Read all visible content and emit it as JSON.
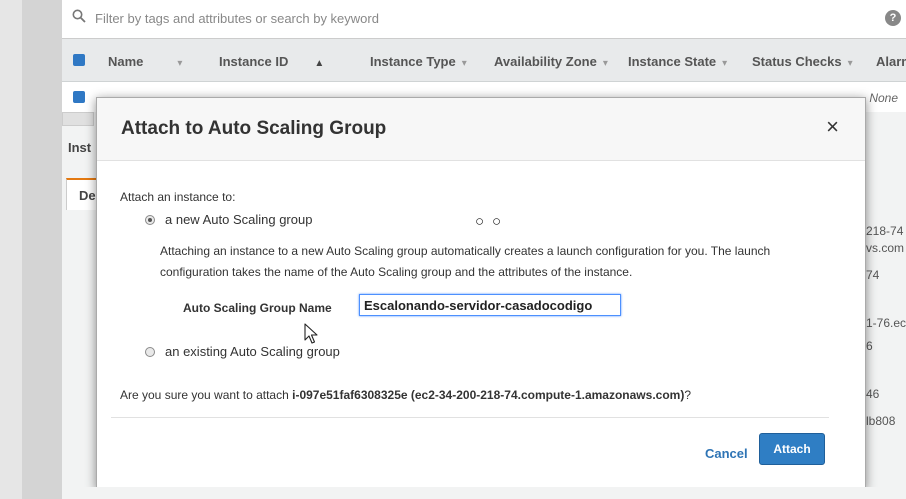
{
  "console": {
    "search_placeholder": "Filter by tags and attributes or search by keyword",
    "help_label": "?",
    "columns": [
      "Name",
      "Instance ID",
      "Instance Type",
      "Availability Zone",
      "Instance State",
      "Status Checks",
      "Alarm"
    ],
    "alarm_value": "None",
    "instances_label": "Inst",
    "details_tab": "De",
    "right_fragments": [
      "218-74",
      "vs.com",
      "74",
      "1-76.ec",
      "6",
      "46",
      "lb808"
    ]
  },
  "modal": {
    "title": "Attach to Auto Scaling Group",
    "close_label": "×",
    "attach_prompt": "Attach an instance to:",
    "option_new": "a new Auto Scaling group",
    "option_existing": "an existing Auto Scaling group",
    "selected_option": "new",
    "explanation": "Attaching an instance to a new Auto Scaling group automatically creates a launch configuration for you. The launch configuration takes the name of the Auto Scaling group and the attributes of the instance.",
    "group_name_label": "Auto Scaling Group Name",
    "group_name_value": "Escalonando-servidor-casadocodigo",
    "circles": "○○",
    "confirm_prefix": "Are you sure you want to attach ",
    "confirm_instance": "i-097e51faf6308325e (ec2-34-200-218-74.compute-1.amazonaws.com)",
    "confirm_suffix": "?",
    "cancel_label": "Cancel",
    "attach_label": "Attach"
  },
  "colors": {
    "primary_button": "#2f7ec4",
    "link": "#2e74b5",
    "checkbox": "#2f78c4"
  }
}
